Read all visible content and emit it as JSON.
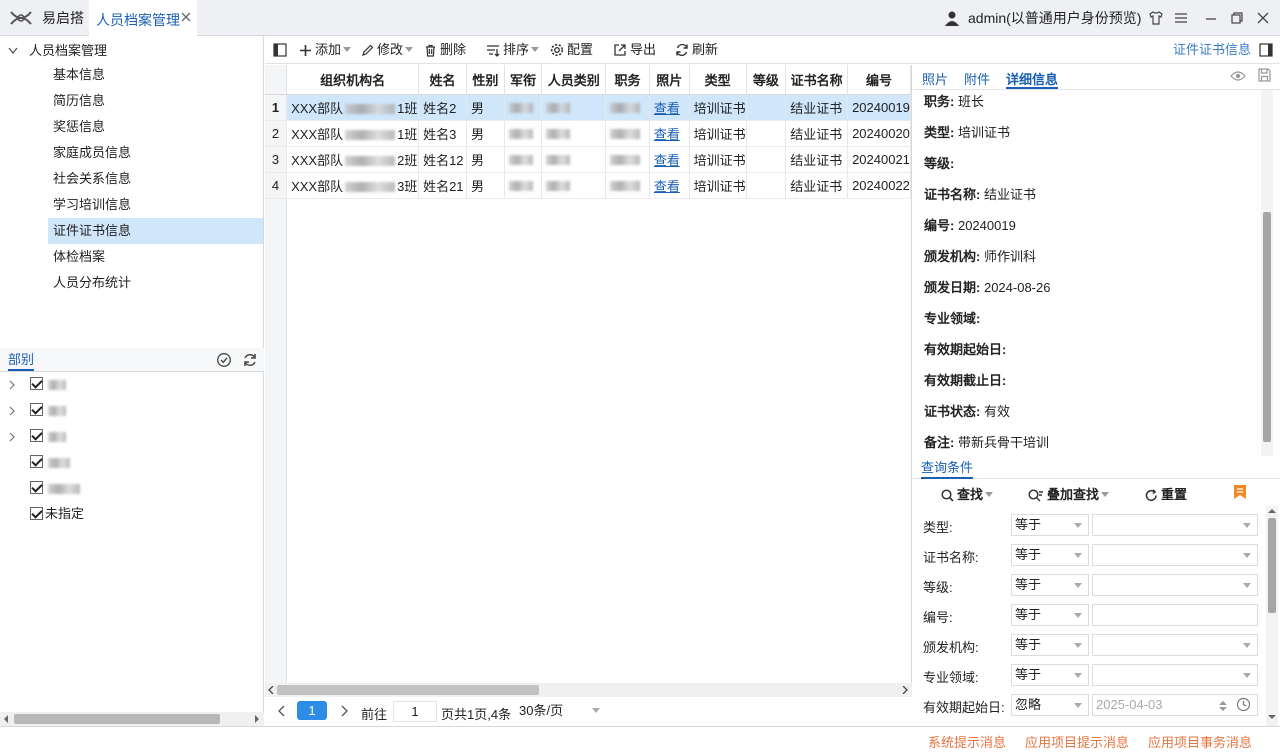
{
  "titlebar": {
    "app_tab": "易启搭",
    "active_tab": "人员档案管理",
    "user": "admin(以普通用户身份预览)"
  },
  "left_tree": {
    "root": "人员档案管理",
    "items": [
      {
        "label": "基本信息"
      },
      {
        "label": "简历信息"
      },
      {
        "label": "奖惩信息"
      },
      {
        "label": "家庭成员信息"
      },
      {
        "label": "社会关系信息"
      },
      {
        "label": "学习培训信息"
      },
      {
        "label": "证件证书信息",
        "selected": true
      },
      {
        "label": "体检档案"
      },
      {
        "label": "人员分布统计"
      }
    ]
  },
  "dept": {
    "title": "部别",
    "last_item": "未指定"
  },
  "toolbar": {
    "add": "添加",
    "edit": "修改",
    "delete": "删除",
    "sort": "排序",
    "config": "配置",
    "export": "导出",
    "refresh": "刷新",
    "right_title": "证件证书信息"
  },
  "table": {
    "headers": [
      "组织机构名",
      "姓名",
      "性别",
      "军衔",
      "人员类别",
      "职务",
      "照片",
      "类型",
      "等级",
      "证书名称",
      "编号"
    ],
    "rows": [
      {
        "n": "1",
        "org_prefix": "XXX部队",
        "org_suffix": "1班",
        "name": "姓名2",
        "sex": "男",
        "photo": "查看",
        "type": "培训证书",
        "cert": "结业证书",
        "no": "20240019"
      },
      {
        "n": "2",
        "org_prefix": "XXX部队",
        "org_suffix": "1班",
        "name": "姓名3",
        "sex": "男",
        "photo": "查看",
        "type": "培训证书",
        "cert": "结业证书",
        "no": "20240020"
      },
      {
        "n": "3",
        "org_prefix": "XXX部队",
        "org_suffix": "2班",
        "name": "姓名12",
        "sex": "男",
        "photo": "查看",
        "type": "培训证书",
        "cert": "结业证书",
        "no": "20240021"
      },
      {
        "n": "4",
        "org_prefix": "XXX部队",
        "org_suffix": "3班",
        "name": "姓名21",
        "sex": "男",
        "photo": "查看",
        "type": "培训证书",
        "cert": "结业证书",
        "no": "20240022"
      }
    ]
  },
  "pager": {
    "current": "1",
    "goto_label": "前往",
    "goto_value": "1",
    "summary": "页共1页,4条",
    "page_size": "30条/页"
  },
  "detail": {
    "tabs": [
      "照片",
      "附件",
      "详细信息"
    ],
    "fields": [
      {
        "k": "职务:",
        "v": "班长"
      },
      {
        "k": "类型:",
        "v": "培训证书"
      },
      {
        "k": "等级:",
        "v": ""
      },
      {
        "k": "证书名称:",
        "v": "结业证书"
      },
      {
        "k": "编号:",
        "v": "20240019"
      },
      {
        "k": "颁发机构:",
        "v": "师作训科"
      },
      {
        "k": "颁发日期:",
        "v": "2024-08-26"
      },
      {
        "k": "专业领域:",
        "v": ""
      },
      {
        "k": "有效期起始日:",
        "v": ""
      },
      {
        "k": "有效期截止日:",
        "v": ""
      },
      {
        "k": "证书状态:",
        "v": "有效"
      },
      {
        "k": "备注:",
        "v": "带新兵骨干培训"
      }
    ]
  },
  "query": {
    "title": "查询条件",
    "find": "查找",
    "add_find": "叠加查找",
    "reset": "重置",
    "rows": [
      {
        "label": "类型:",
        "op": "等于",
        "value": "",
        "dropdown": true
      },
      {
        "label": "证书名称:",
        "op": "等于",
        "value": "",
        "dropdown": true
      },
      {
        "label": "等级:",
        "op": "等于",
        "value": "",
        "dropdown": true
      },
      {
        "label": "编号:",
        "op": "等于",
        "value": "",
        "dropdown": false
      },
      {
        "label": "颁发机构:",
        "op": "等于",
        "value": "",
        "dropdown": true
      },
      {
        "label": "专业领域:",
        "op": "等于",
        "value": "",
        "dropdown": true
      },
      {
        "label": "有效期起始日:",
        "op": "忽略",
        "value": "2025-04-03",
        "dropdown": false
      }
    ]
  },
  "status": {
    "sys": "系统提示消息",
    "app": "应用项目提示消息",
    "task": "应用项目事务消息"
  }
}
